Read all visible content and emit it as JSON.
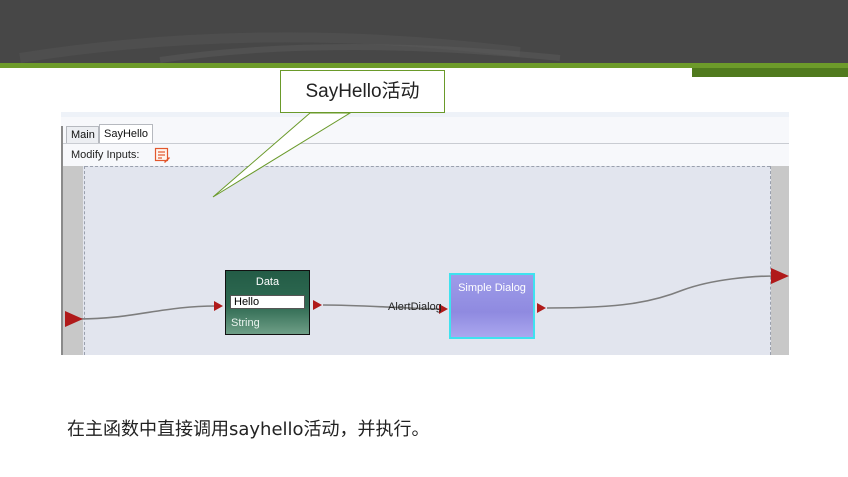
{
  "tabs": [
    {
      "label": "Main"
    },
    {
      "label": "SayHello"
    }
  ],
  "toolbar": {
    "modify_inputs_label": "Modify Inputs:",
    "icon": "edit-list-icon"
  },
  "nodes": {
    "data": {
      "title": "Data",
      "value": "Hello",
      "type": "String"
    },
    "dialog": {
      "title": "Simple Dialog"
    }
  },
  "edge": {
    "label": "AlertDialog"
  },
  "callout": {
    "text": "SayHello活动"
  },
  "caption": "在主函数中直接调用sayhello活动，并执行。",
  "colors": {
    "header": "#474747",
    "accent_green": "#6d9b2a",
    "canvas": "#e2e5ee",
    "port": "#b01a1a"
  }
}
